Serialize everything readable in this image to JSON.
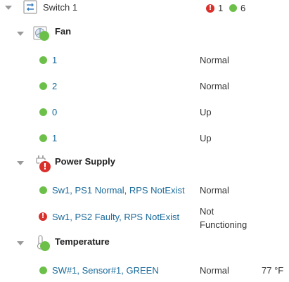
{
  "tree": {
    "switch": {
      "label": "Switch 1",
      "icon": "switch-icon",
      "summary": {
        "critical_count": "1",
        "ok_count": "6"
      }
    },
    "groups": [
      {
        "label": "Fan",
        "icon": "fan-icon",
        "status_color": "#6cc04a",
        "items": [
          {
            "name": "1",
            "status": "Normal",
            "status_color": "#6cc04a"
          },
          {
            "name": "2",
            "status": "Normal",
            "status_color": "#6cc04a"
          },
          {
            "name": "0",
            "status": "Up",
            "status_color": "#6cc04a"
          },
          {
            "name": "1",
            "status": "Up",
            "status_color": "#6cc04a"
          }
        ]
      },
      {
        "label": "Power Supply",
        "icon": "power-plug-icon",
        "status_color": "#d9302c",
        "items": [
          {
            "name": "Sw1, PS1 Normal, RPS NotExist",
            "status": "Normal",
            "status_color": "#6cc04a"
          },
          {
            "name": "Sw1, PS2 Faulty, RPS NotExist",
            "status_line1": "Not",
            "status_line2": "Functioning",
            "status_color": "#d9302c"
          }
        ]
      },
      {
        "label": "Temperature",
        "icon": "thermometer-icon",
        "status_color": "#6cc04a",
        "items": [
          {
            "name": "SW#1, Sensor#1, GREEN",
            "status": "Normal",
            "value": "77 °F",
            "status_color": "#6cc04a"
          }
        ]
      }
    ]
  },
  "colors": {
    "ok": "#6cc04a",
    "critical": "#d9302c",
    "link": "#1a6a9a"
  }
}
